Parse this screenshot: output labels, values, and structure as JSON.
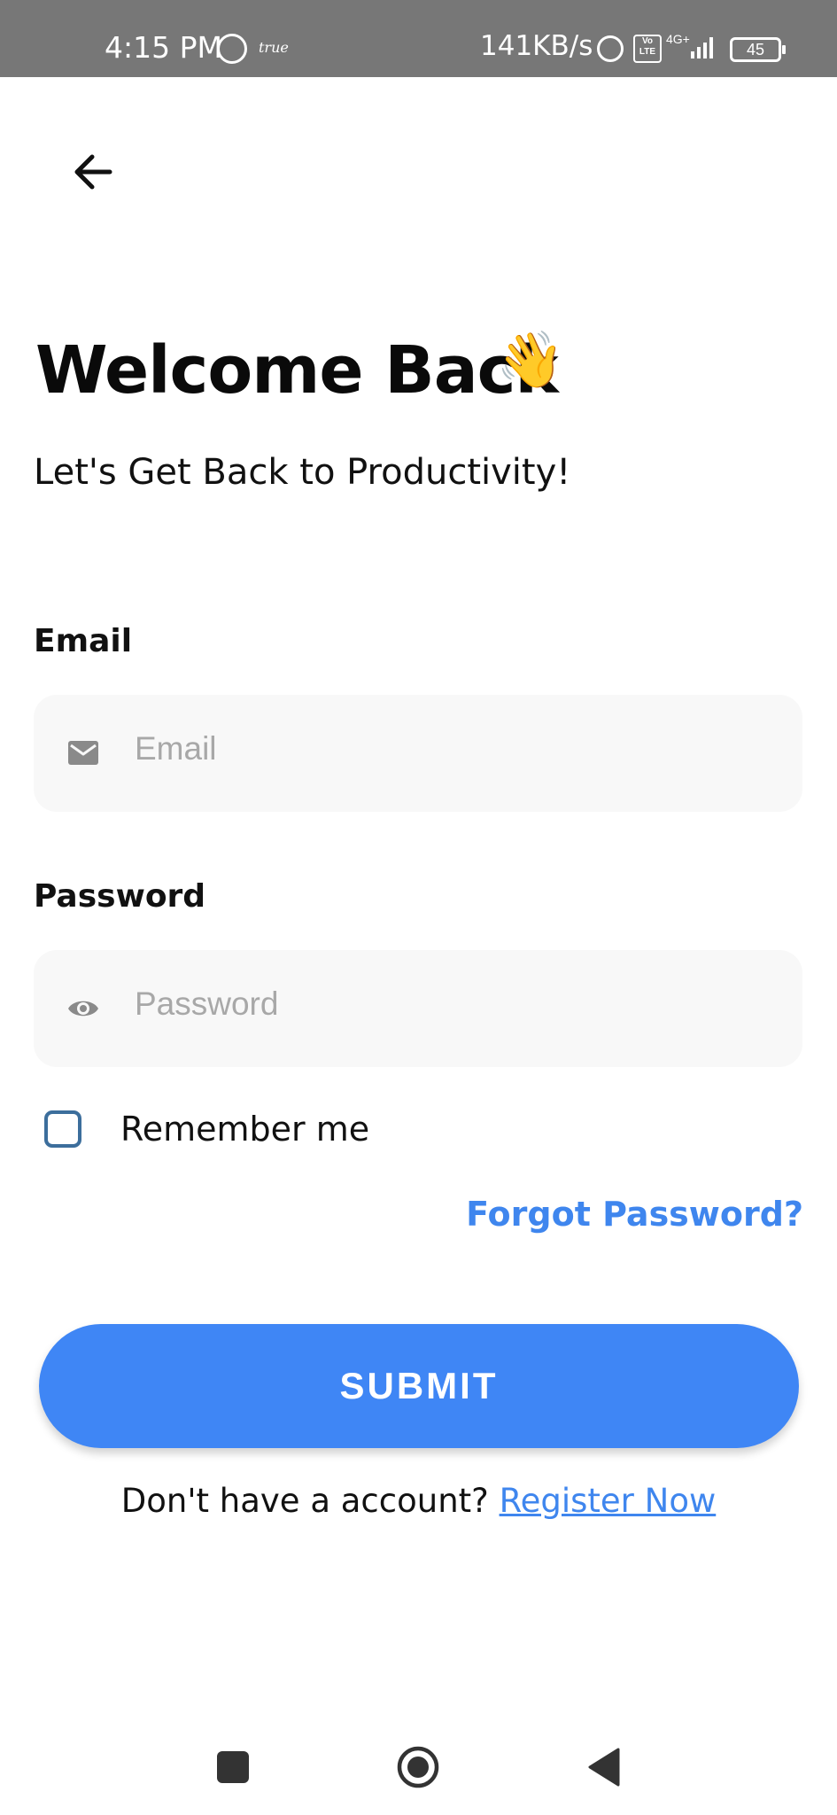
{
  "status_bar": {
    "time": "4:15 PM",
    "carrier_note": "true",
    "speed": "141KB/s",
    "volte": "Vo LTE",
    "network": "4G+",
    "battery": "45"
  },
  "header": {
    "back_icon": "arrow-left-icon"
  },
  "title": "Welcome Back",
  "title_emoji": "👋",
  "subtitle": "Let's Get Back to Productivity!",
  "form": {
    "email_label": "Email",
    "email_placeholder": "Email",
    "email_icon": "envelope-icon",
    "password_label": "Password",
    "password_placeholder": "Password",
    "password_icon": "eye-icon",
    "remember_label": "Remember me",
    "remember_checked": false,
    "forgot_label": "Forgot Password?",
    "submit_label": "SUBMIT"
  },
  "footer": {
    "prompt": "Don't have a account?",
    "register_label": "Register Now"
  },
  "colors": {
    "accent": "#3f86f5",
    "link": "#3f86ee",
    "field_bg": "#f8f8f8",
    "status_bar": "#777777"
  }
}
